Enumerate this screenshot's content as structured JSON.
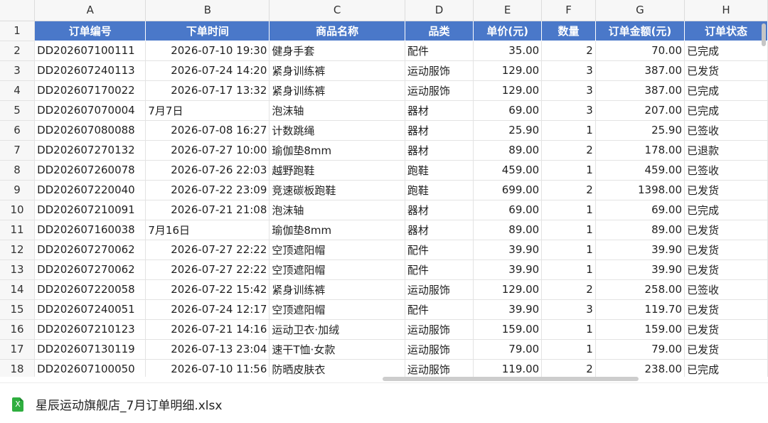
{
  "columns": [
    "A",
    "B",
    "C",
    "D",
    "E",
    "F",
    "G",
    "H"
  ],
  "headers": [
    "订单编号",
    "下单时间",
    "商品名称",
    "品类",
    "单价(元)",
    "数量",
    "订单金额(元)",
    "订单状态"
  ],
  "header_row_num": "1",
  "rows": [
    {
      "n": "2",
      "id": "DD202607100111",
      "time": "2026-07-10 19:30",
      "time_left": false,
      "product": "健身手套",
      "cat": "配件",
      "price": "35.00",
      "qty": "2",
      "amount": "70.00",
      "status": "已完成"
    },
    {
      "n": "3",
      "id": "DD202607240113",
      "time": "2026-07-24 14:20",
      "time_left": false,
      "product": "紧身训练裤",
      "cat": "运动服饰",
      "price": "129.00",
      "qty": "3",
      "amount": "387.00",
      "status": "已发货"
    },
    {
      "n": "4",
      "id": "DD202607170022",
      "time": "2026-07-17 13:32",
      "time_left": false,
      "product": "紧身训练裤",
      "cat": "运动服饰",
      "price": "129.00",
      "qty": "3",
      "amount": "387.00",
      "status": "已完成"
    },
    {
      "n": "5",
      "id": "DD202607070004",
      "time": "7月7日",
      "time_left": true,
      "product": "泡沫轴",
      "cat": "器材",
      "price": "69.00",
      "qty": "3",
      "amount": "207.00",
      "status": "已完成"
    },
    {
      "n": "6",
      "id": "DD202607080088",
      "time": "2026-07-08 16:27",
      "time_left": false,
      "product": "计数跳绳",
      "cat": "器材",
      "price": "25.90",
      "qty": "1",
      "amount": "25.90",
      "status": "已签收"
    },
    {
      "n": "7",
      "id": "DD202607270132",
      "time": "2026-07-27 10:00",
      "time_left": false,
      "product": "瑜伽垫8mm",
      "cat": "器材",
      "price": "89.00",
      "qty": "2",
      "amount": "178.00",
      "status": "已退款"
    },
    {
      "n": "8",
      "id": "DD202607260078",
      "time": "2026-07-26 22:03",
      "time_left": false,
      "product": "越野跑鞋",
      "cat": "跑鞋",
      "price": "459.00",
      "qty": "1",
      "amount": "459.00",
      "status": "已签收"
    },
    {
      "n": "9",
      "id": "DD202607220040",
      "time": "2026-07-22 23:09",
      "time_left": false,
      "product": "竞速碳板跑鞋",
      "cat": "跑鞋",
      "price": "699.00",
      "qty": "2",
      "amount": "1398.00",
      "status": "已发货"
    },
    {
      "n": "10",
      "id": "DD202607210091",
      "time": "2026-07-21 21:08",
      "time_left": false,
      "product": "泡沫轴",
      "cat": "器材",
      "price": "69.00",
      "qty": "1",
      "amount": "69.00",
      "status": "已完成"
    },
    {
      "n": "11",
      "id": "DD202607160038",
      "time": "7月16日",
      "time_left": true,
      "product": "瑜伽垫8mm",
      "cat": "器材",
      "price": "89.00",
      "qty": "1",
      "amount": "89.00",
      "status": "已发货"
    },
    {
      "n": "12",
      "id": "DD202607270062",
      "time": "2026-07-27 22:22",
      "time_left": false,
      "product": "空顶遮阳帽",
      "cat": "配件",
      "price": "39.90",
      "qty": "1",
      "amount": "39.90",
      "status": "已发货"
    },
    {
      "n": "13",
      "id": "DD202607270062",
      "time": "2026-07-27 22:22",
      "time_left": false,
      "product": "空顶遮阳帽",
      "cat": "配件",
      "price": "39.90",
      "qty": "1",
      "amount": "39.90",
      "status": "已发货"
    },
    {
      "n": "14",
      "id": "DD202607220058",
      "time": "2026-07-22 15:42",
      "time_left": false,
      "product": "紧身训练裤",
      "cat": "运动服饰",
      "price": "129.00",
      "qty": "2",
      "amount": "258.00",
      "status": "已签收"
    },
    {
      "n": "15",
      "id": "DD202607240051",
      "time": "2026-07-24 12:17",
      "time_left": false,
      "product": "空顶遮阳帽",
      "cat": "配件",
      "price": "39.90",
      "qty": "3",
      "amount": "119.70",
      "status": "已发货"
    },
    {
      "n": "16",
      "id": "DD202607210123",
      "time": "2026-07-21 14:16",
      "time_left": false,
      "product": "运动卫衣·加绒",
      "cat": "运动服饰",
      "price": "159.00",
      "qty": "1",
      "amount": "159.00",
      "status": "已发货"
    },
    {
      "n": "17",
      "id": "DD202607130119",
      "time": "2026-07-13 23:04",
      "time_left": false,
      "product": "速干T恤·女款",
      "cat": "运动服饰",
      "price": "79.00",
      "qty": "1",
      "amount": "79.00",
      "status": "已发货"
    },
    {
      "n": "18",
      "id": "DD202607100050",
      "time": "2026-07-10 11:56",
      "time_left": false,
      "product": "防晒皮肤衣",
      "cat": "运动服饰",
      "price": "119.00",
      "qty": "2",
      "amount": "238.00",
      "status": "已完成"
    }
  ],
  "file": {
    "name": "星辰运动旗舰店_7月订单明细.xlsx",
    "icon": "excel-file-icon",
    "icon_glyph": "X"
  },
  "colors": {
    "header_bg": "#4a78c9",
    "file_icon": "#2fae3f"
  }
}
